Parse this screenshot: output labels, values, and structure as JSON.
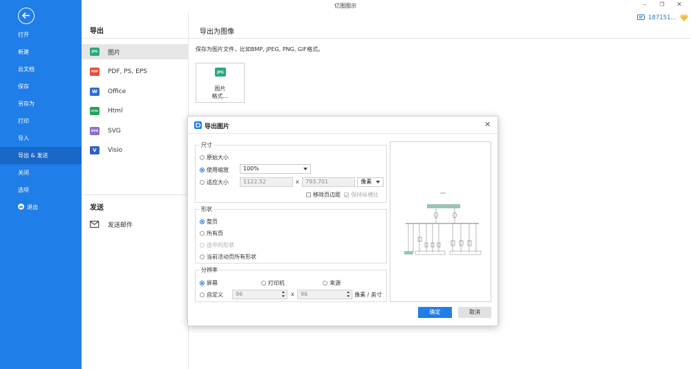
{
  "app": {
    "title": "亿图图示",
    "user": "187151..."
  },
  "sidebar": {
    "items": [
      {
        "label": "打开",
        "name": "open"
      },
      {
        "label": "新建",
        "name": "new"
      },
      {
        "label": "云文档",
        "name": "cloud-docs"
      },
      {
        "label": "保存",
        "name": "save"
      },
      {
        "label": "另存为",
        "name": "save-as"
      },
      {
        "label": "打印",
        "name": "print"
      },
      {
        "label": "导入",
        "name": "import"
      },
      {
        "label": "导出 & 发送",
        "name": "export-send"
      },
      {
        "label": "关闭",
        "name": "close"
      },
      {
        "label": "选项",
        "name": "options"
      }
    ],
    "exit_label": "退出",
    "active_index": 7
  },
  "export_panel": {
    "title": "导出",
    "formats": [
      {
        "label": "图片",
        "icon": "jpg-icon",
        "badge": "JPG",
        "color": "#2aa87e"
      },
      {
        "label": "PDF, PS, EPS",
        "icon": "pdf-icon",
        "badge": "PDF",
        "color": "#e84c3d"
      },
      {
        "label": "Office",
        "icon": "word-icon",
        "badge": "W",
        "color": "#2b6fd6"
      },
      {
        "label": "Html",
        "icon": "html-icon",
        "badge": "HTML",
        "color": "#27a35a"
      },
      {
        "label": "SVG",
        "icon": "svg-icon",
        "badge": "SVG",
        "color": "#8b6fd0"
      },
      {
        "label": "Visio",
        "icon": "visio-icon",
        "badge": "V",
        "color": "#3360c4"
      }
    ],
    "active_index": 0
  },
  "send_panel": {
    "title": "发送",
    "email_label": "发送邮件"
  },
  "content": {
    "title": "导出为图像",
    "description": "保存为图片文件，比如BMP, JPEG, PNG, GIF格式。",
    "card_line1": "图片",
    "card_line2": "格式..."
  },
  "dialog": {
    "title": "导出图片",
    "size": {
      "label": "尺寸",
      "original": "原始大小",
      "use_zoom": "使用缩放",
      "zoom_value": "100%",
      "fit_size": "适应大小",
      "width": "1122.52",
      "times": "x",
      "height": "793.701",
      "unit": "像素",
      "remove_margin": "移除页边距",
      "keep_ratio": "保持纵横比"
    },
    "shape": {
      "label": "形状",
      "whole_page": "整页",
      "all_pages": "所有页",
      "selected": "选中的形状",
      "current_all": "当前活动页所有形状"
    },
    "resolution": {
      "label": "分辨率",
      "screen": "屏幕",
      "printer": "打印机",
      "source": "来源",
      "custom": "自定义",
      "dpi_x": "96",
      "times": "x",
      "dpi_y": "96",
      "unit": "像素 / 英寸"
    },
    "ok": "确定",
    "cancel": "取消"
  }
}
